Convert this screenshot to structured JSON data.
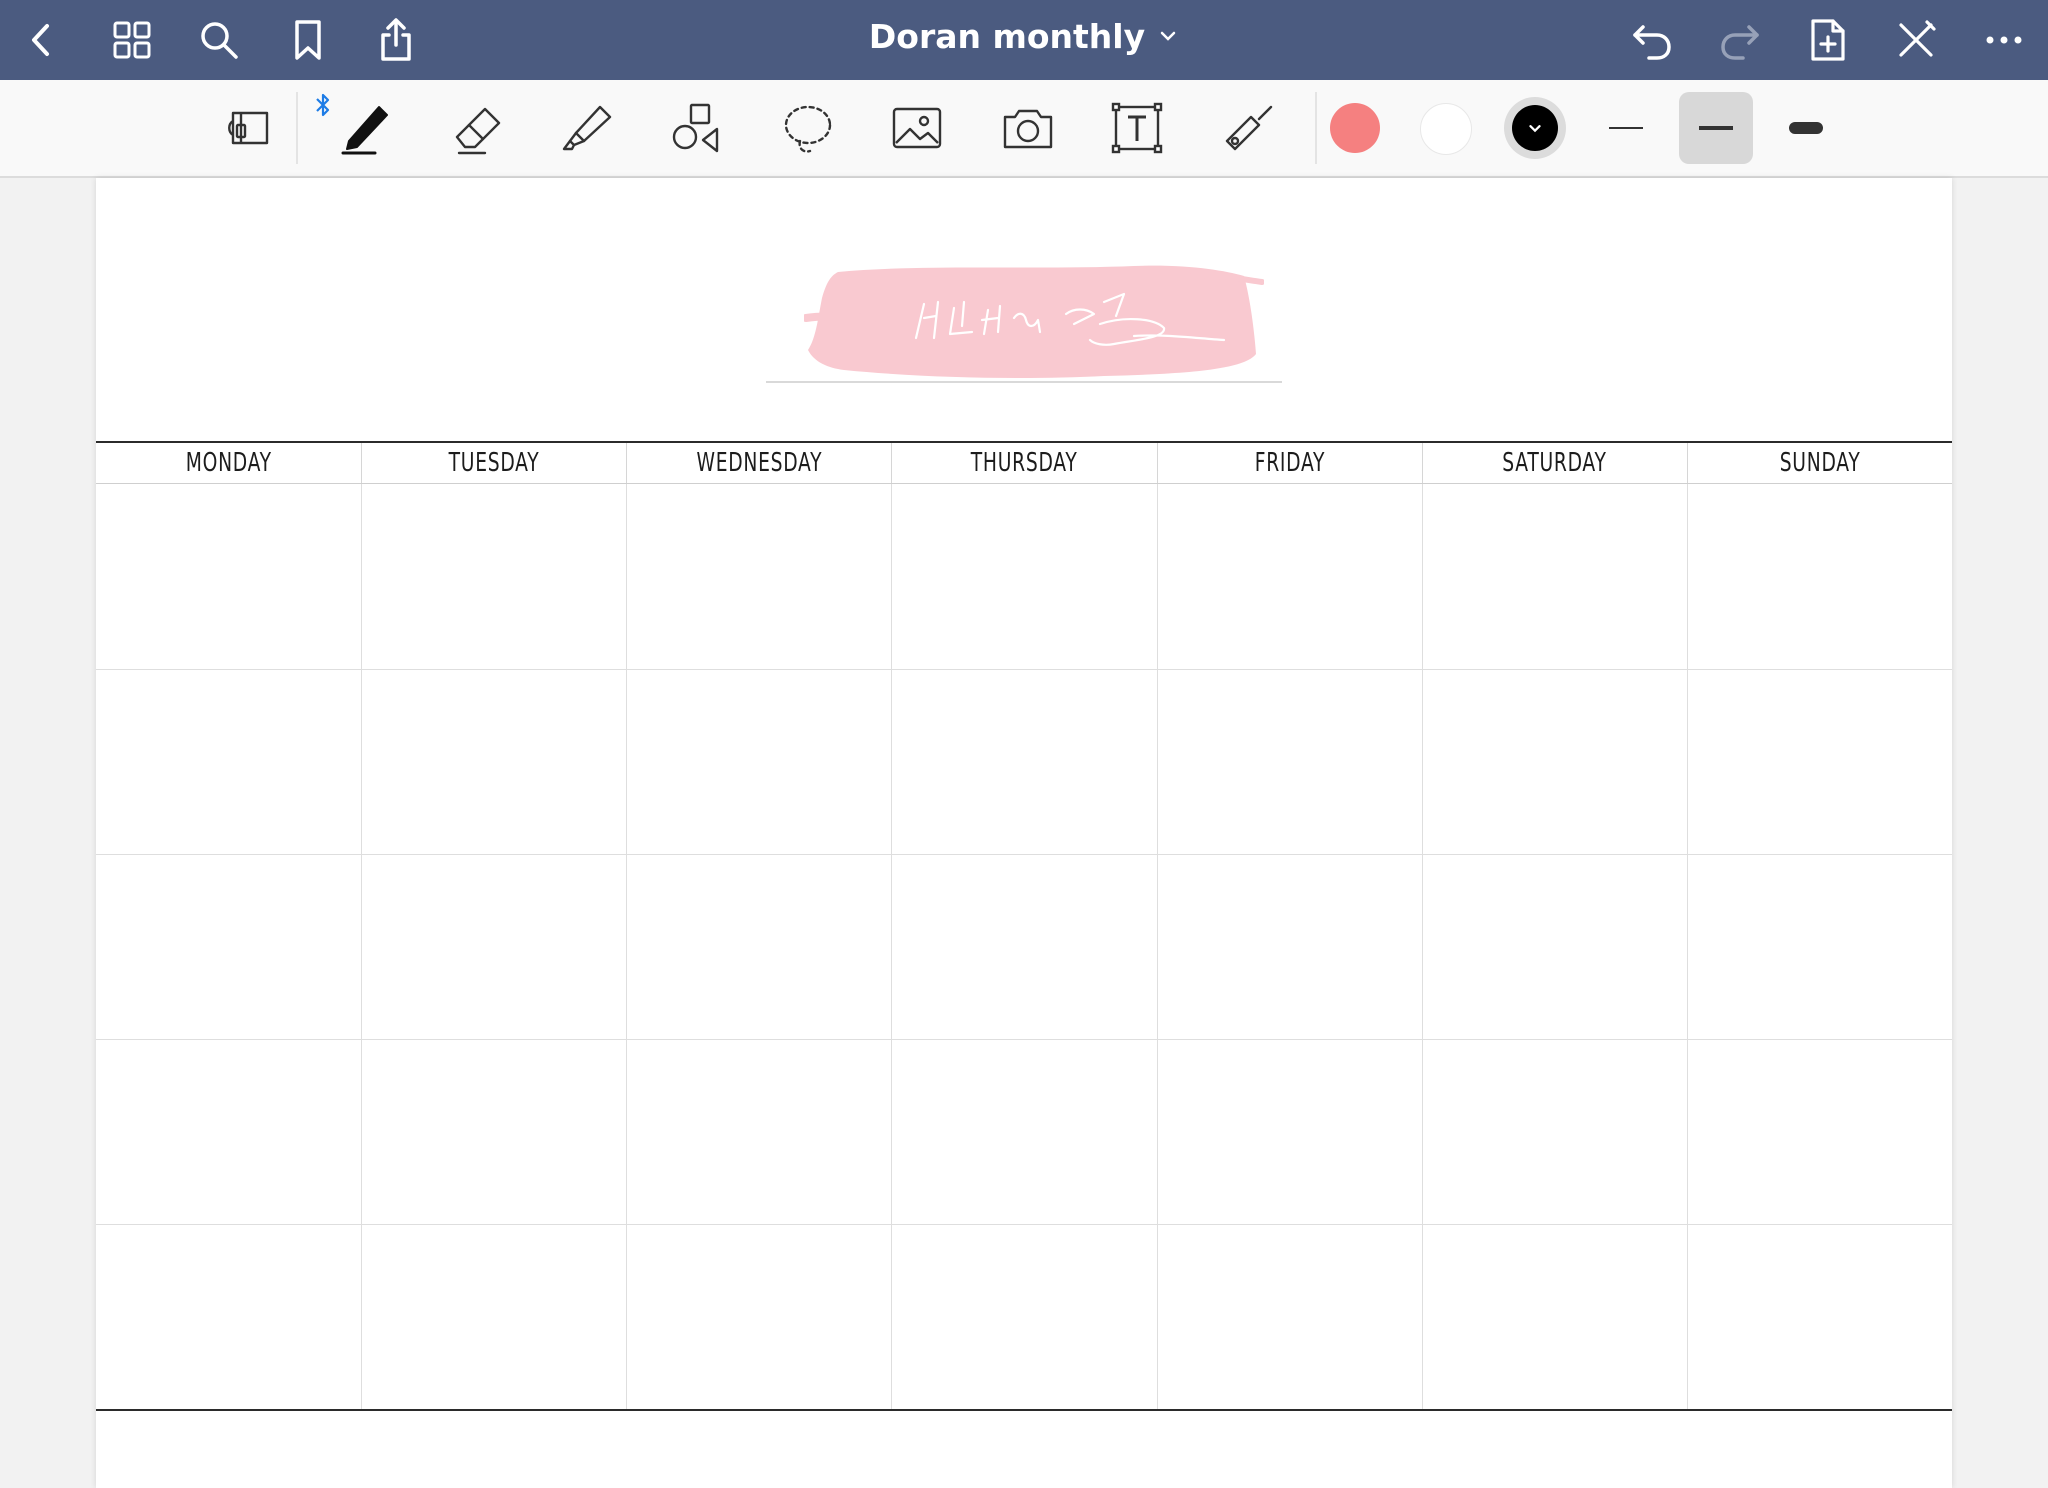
{
  "navbar": {
    "background": "#4b5b80",
    "title": "Doran monthly",
    "left_icons": [
      "back-icon",
      "grid-icon",
      "search-icon",
      "bookmark-icon",
      "share-icon"
    ],
    "right_icons": [
      "undo-icon",
      "redo-icon",
      "add-page-icon",
      "close-pen-icon",
      "more-icon"
    ]
  },
  "toolbar": {
    "tools": [
      "read-only-mode",
      "pen",
      "eraser",
      "highlighter",
      "shapes",
      "lasso",
      "image",
      "camera",
      "text",
      "laser-pointer"
    ],
    "selected_tool": "pen",
    "bluetooth_connected": true,
    "colors": [
      "#f58080",
      "#ffffff",
      "#000000"
    ],
    "selected_color": "#000000",
    "stroke_widths": [
      "thin",
      "medium",
      "thick"
    ],
    "selected_stroke": "medium"
  },
  "page": {
    "title_banner_color": "#f9c9d0",
    "calendar": {
      "day_headers": [
        "MONDAY",
        "TUESDAY",
        "WEDNESDAY",
        "THURSDAY",
        "FRIDAY",
        "SATURDAY",
        "SUNDAY"
      ],
      "week_rows": 5
    }
  }
}
